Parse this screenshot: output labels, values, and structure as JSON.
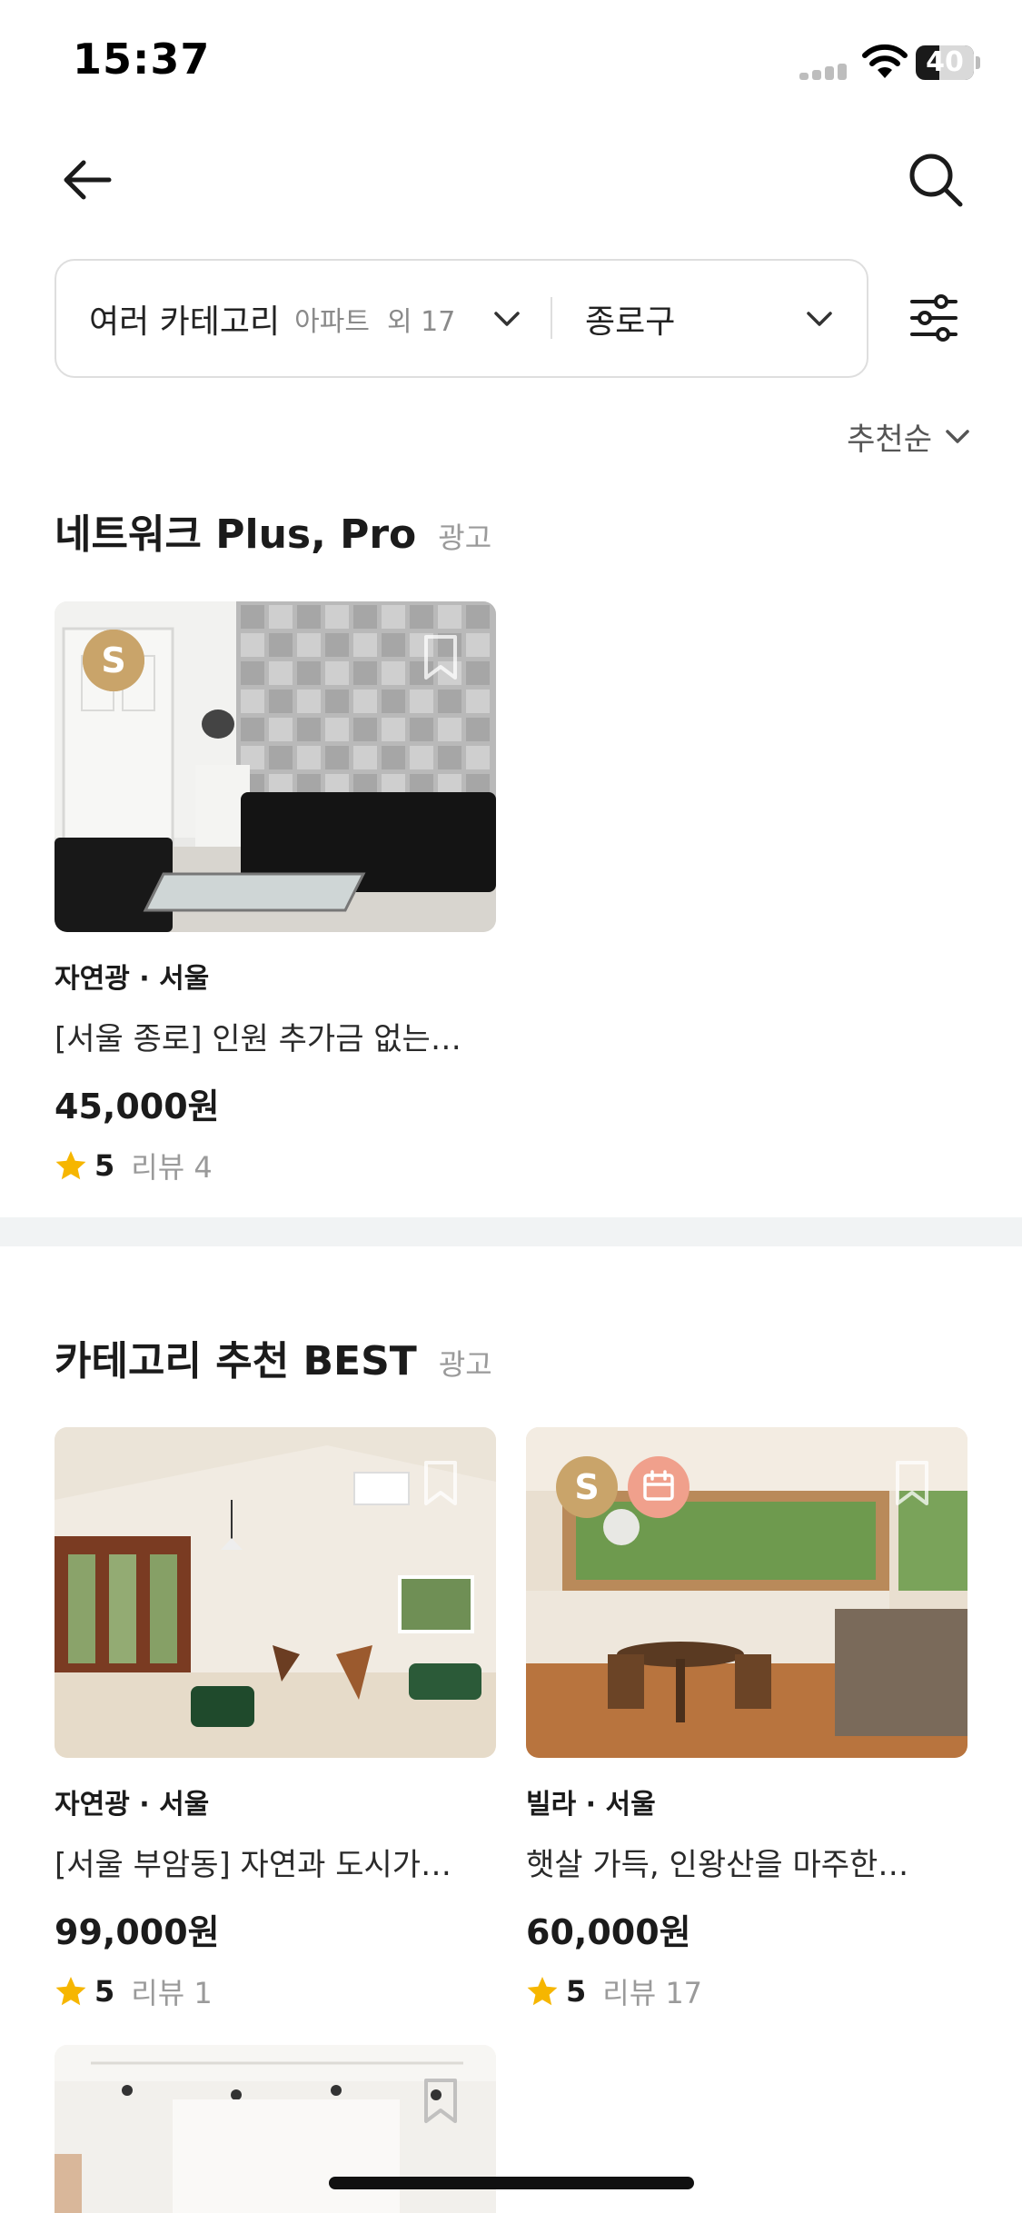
{
  "status_bar": {
    "time": "15:37",
    "battery": "40",
    "battery_level": 0.4,
    "icons": [
      "signal-icon",
      "wifi-icon",
      "battery-icon"
    ]
  },
  "header": {
    "back_icon": "arrow-left-icon",
    "search_icon": "search-icon"
  },
  "filter": {
    "category_label": "여러 카테고리",
    "category_detail": "아파트  외 17",
    "region_label": "종로구",
    "settings_icon": "sliders-icon"
  },
  "sort": {
    "label": "추천순"
  },
  "sections": [
    {
      "title": "네트워크 Plus, Pro",
      "ad_label": "광고",
      "cards": [
        {
          "category": "자연광 · 서울",
          "title": "[서울 종로] 인원 추가금 없는…",
          "price": "45,000원",
          "rating": "5",
          "reviews": "리뷰 4",
          "badges": [
            "S"
          ]
        }
      ]
    },
    {
      "title": "카테고리 추천 BEST",
      "ad_label": "광고",
      "cards": [
        {
          "category": "자연광 · 서울",
          "title": "[서울 부암동] 자연과 도시가…",
          "price": "99,000원",
          "rating": "5",
          "reviews": "리뷰 1",
          "badges": []
        },
        {
          "category": "빌라 · 서울",
          "title": "햇살 가득, 인왕산을 마주한…",
          "price": "60,000원",
          "rating": "5",
          "reviews": "리뷰 17",
          "badges": [
            "S",
            "calendar-icon"
          ]
        }
      ]
    }
  ],
  "colors": {
    "badge_s": "#c9a46a",
    "badge_calendar": "#f0a08c",
    "star": "#f6b600",
    "divider": "#f1f3f4"
  }
}
